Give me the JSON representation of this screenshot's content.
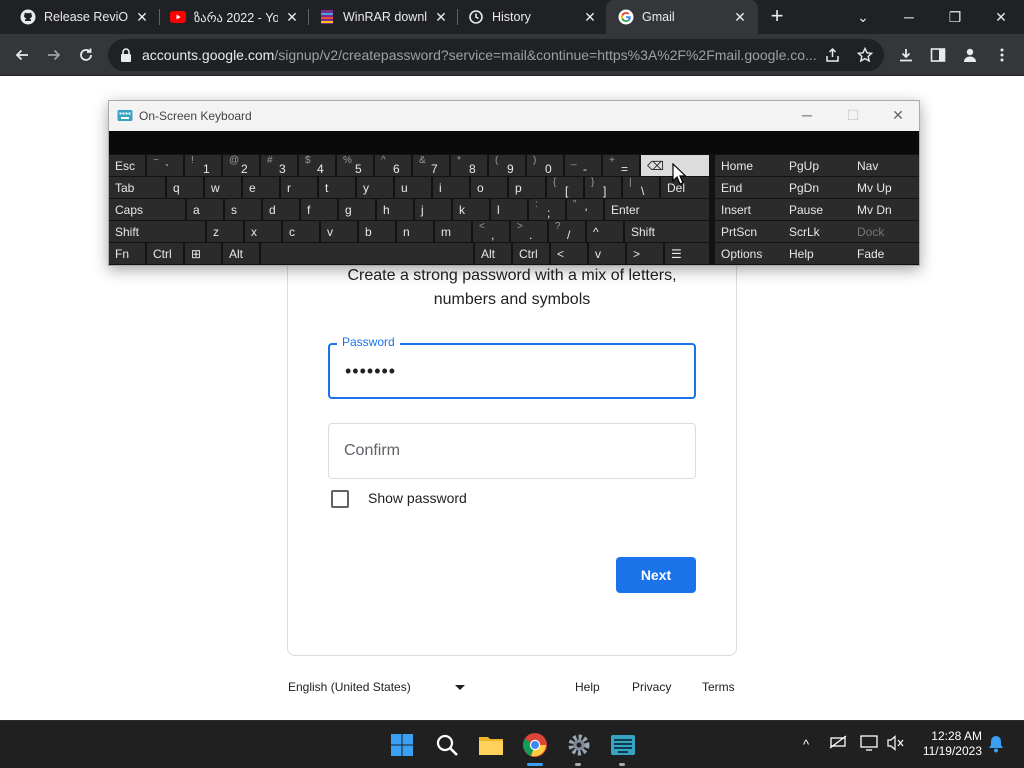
{
  "browser": {
    "tabs": [
      {
        "title": "Release ReviOS",
        "icon": "github-icon"
      },
      {
        "title": "ზარა 2022 - Yo",
        "icon": "youtube-icon"
      },
      {
        "title": "WinRAR downlo",
        "icon": "winrar-icon"
      },
      {
        "title": "History",
        "icon": "history-icon"
      },
      {
        "title": "Gmail",
        "icon": "google-icon"
      }
    ],
    "url_host": "accounts.google.com",
    "url_path": "/signup/v2/createpassword?service=mail&continue=https%3A%2F%2Fmail.google.co..."
  },
  "osk": {
    "title": "On-Screen Keyboard",
    "rows": [
      [
        {
          "main": "Esc"
        },
        {
          "shift": "~",
          "main": "`"
        },
        {
          "shift": "!",
          "main": "1"
        },
        {
          "shift": "@",
          "main": "2"
        },
        {
          "shift": "#",
          "main": "3"
        },
        {
          "shift": "$",
          "main": "4"
        },
        {
          "shift": "%",
          "main": "5"
        },
        {
          "shift": "^",
          "main": "6"
        },
        {
          "shift": "&",
          "main": "7"
        },
        {
          "shift": "*",
          "main": "8"
        },
        {
          "shift": "(",
          "main": "9"
        },
        {
          "shift": ")",
          "main": "0"
        },
        {
          "shift": "_",
          "main": "-"
        },
        {
          "shift": "+",
          "main": "="
        },
        {
          "main": "⌫"
        },
        {
          "main": "Home"
        },
        {
          "main": "PgUp"
        },
        {
          "main": "Nav"
        }
      ],
      [
        {
          "main": "Tab"
        },
        {
          "main": "q"
        },
        {
          "main": "w"
        },
        {
          "main": "e"
        },
        {
          "main": "r"
        },
        {
          "main": "t"
        },
        {
          "main": "y"
        },
        {
          "main": "u"
        },
        {
          "main": "i"
        },
        {
          "main": "o"
        },
        {
          "main": "p"
        },
        {
          "shift": "{",
          "main": "["
        },
        {
          "shift": "}",
          "main": "]"
        },
        {
          "shift": "|",
          "main": "\\"
        },
        {
          "main": "Del"
        },
        {
          "main": "End"
        },
        {
          "main": "PgDn"
        },
        {
          "main": "Mv Up"
        }
      ],
      [
        {
          "main": "Caps"
        },
        {
          "main": "a"
        },
        {
          "main": "s"
        },
        {
          "main": "d"
        },
        {
          "main": "f"
        },
        {
          "main": "g"
        },
        {
          "main": "h"
        },
        {
          "main": "j"
        },
        {
          "main": "k"
        },
        {
          "main": "l"
        },
        {
          "shift": ":",
          "main": ";"
        },
        {
          "shift": "\"",
          "main": "'"
        },
        {
          "main": "Enter"
        },
        {
          "main": "Insert"
        },
        {
          "main": "Pause"
        },
        {
          "main": "Mv Dn"
        }
      ],
      [
        {
          "main": "Shift"
        },
        {
          "main": "z"
        },
        {
          "main": "x"
        },
        {
          "main": "c"
        },
        {
          "main": "v"
        },
        {
          "main": "b"
        },
        {
          "main": "n"
        },
        {
          "main": "m"
        },
        {
          "shift": "<",
          "main": ","
        },
        {
          "shift": ">",
          "main": "."
        },
        {
          "shift": "?",
          "main": "/"
        },
        {
          "main": "^"
        },
        {
          "main": "Shift"
        },
        {
          "main": "PrtScn"
        },
        {
          "main": "ScrLk"
        },
        {
          "main": "Dock"
        }
      ],
      [
        {
          "main": "Fn"
        },
        {
          "main": "Ctrl"
        },
        {
          "main": "⊞"
        },
        {
          "main": "Alt"
        },
        {
          "main": ""
        },
        {
          "main": "Alt"
        },
        {
          "main": "Ctrl"
        },
        {
          "main": "<"
        },
        {
          "main": "v"
        },
        {
          "main": ">"
        },
        {
          "main": "☰"
        },
        {
          "main": "Options"
        },
        {
          "main": "Help"
        },
        {
          "main": "Fade"
        }
      ]
    ]
  },
  "signup": {
    "subtitle": "Create a strong password with a mix of letters, numbers and symbols",
    "password_label": "Password",
    "password_value": "•••••••",
    "confirm_placeholder": "Confirm",
    "show_password_label": "Show password",
    "next_label": "Next"
  },
  "footer": {
    "language": "English (United States)",
    "help": "Help",
    "privacy": "Privacy",
    "terms": "Terms"
  },
  "taskbar": {
    "time": "12:28 AM",
    "date": "11/19/2023"
  },
  "colors": {
    "accent": "#1a73e8",
    "chrome_dark": "#202124",
    "osk_key": "#2b2b2b"
  }
}
